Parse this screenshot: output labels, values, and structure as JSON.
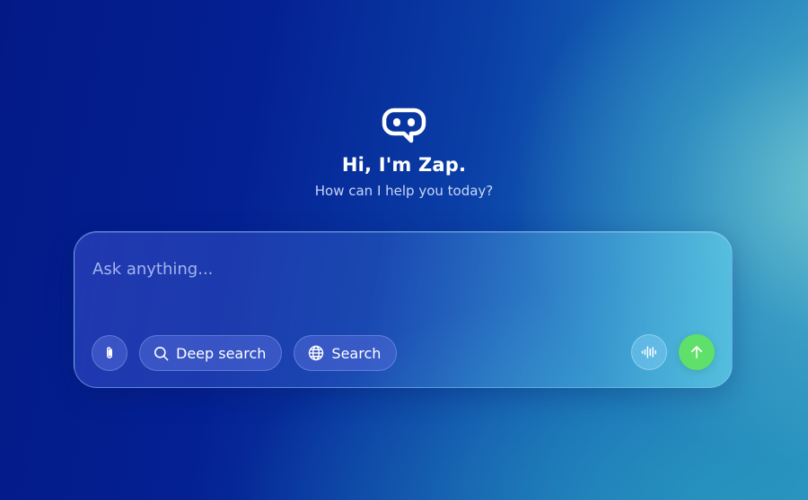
{
  "hero": {
    "title": "Hi, I'm Zap.",
    "subtitle": "How can I help you today?",
    "logo_icon": "bot-chat-icon"
  },
  "chat": {
    "placeholder": "Ask anything...",
    "value": "",
    "attach_icon": "paperclip-icon",
    "deep_search_label": "Deep search",
    "deep_search_icon": "search-icon",
    "search_label": "Search",
    "search_icon": "globe-icon",
    "voice_icon": "waveform-icon",
    "send_icon": "arrow-up-icon"
  },
  "colors": {
    "background_start": "#031a86",
    "background_end": "#78cdd2",
    "send_button": "#5fe06a"
  }
}
